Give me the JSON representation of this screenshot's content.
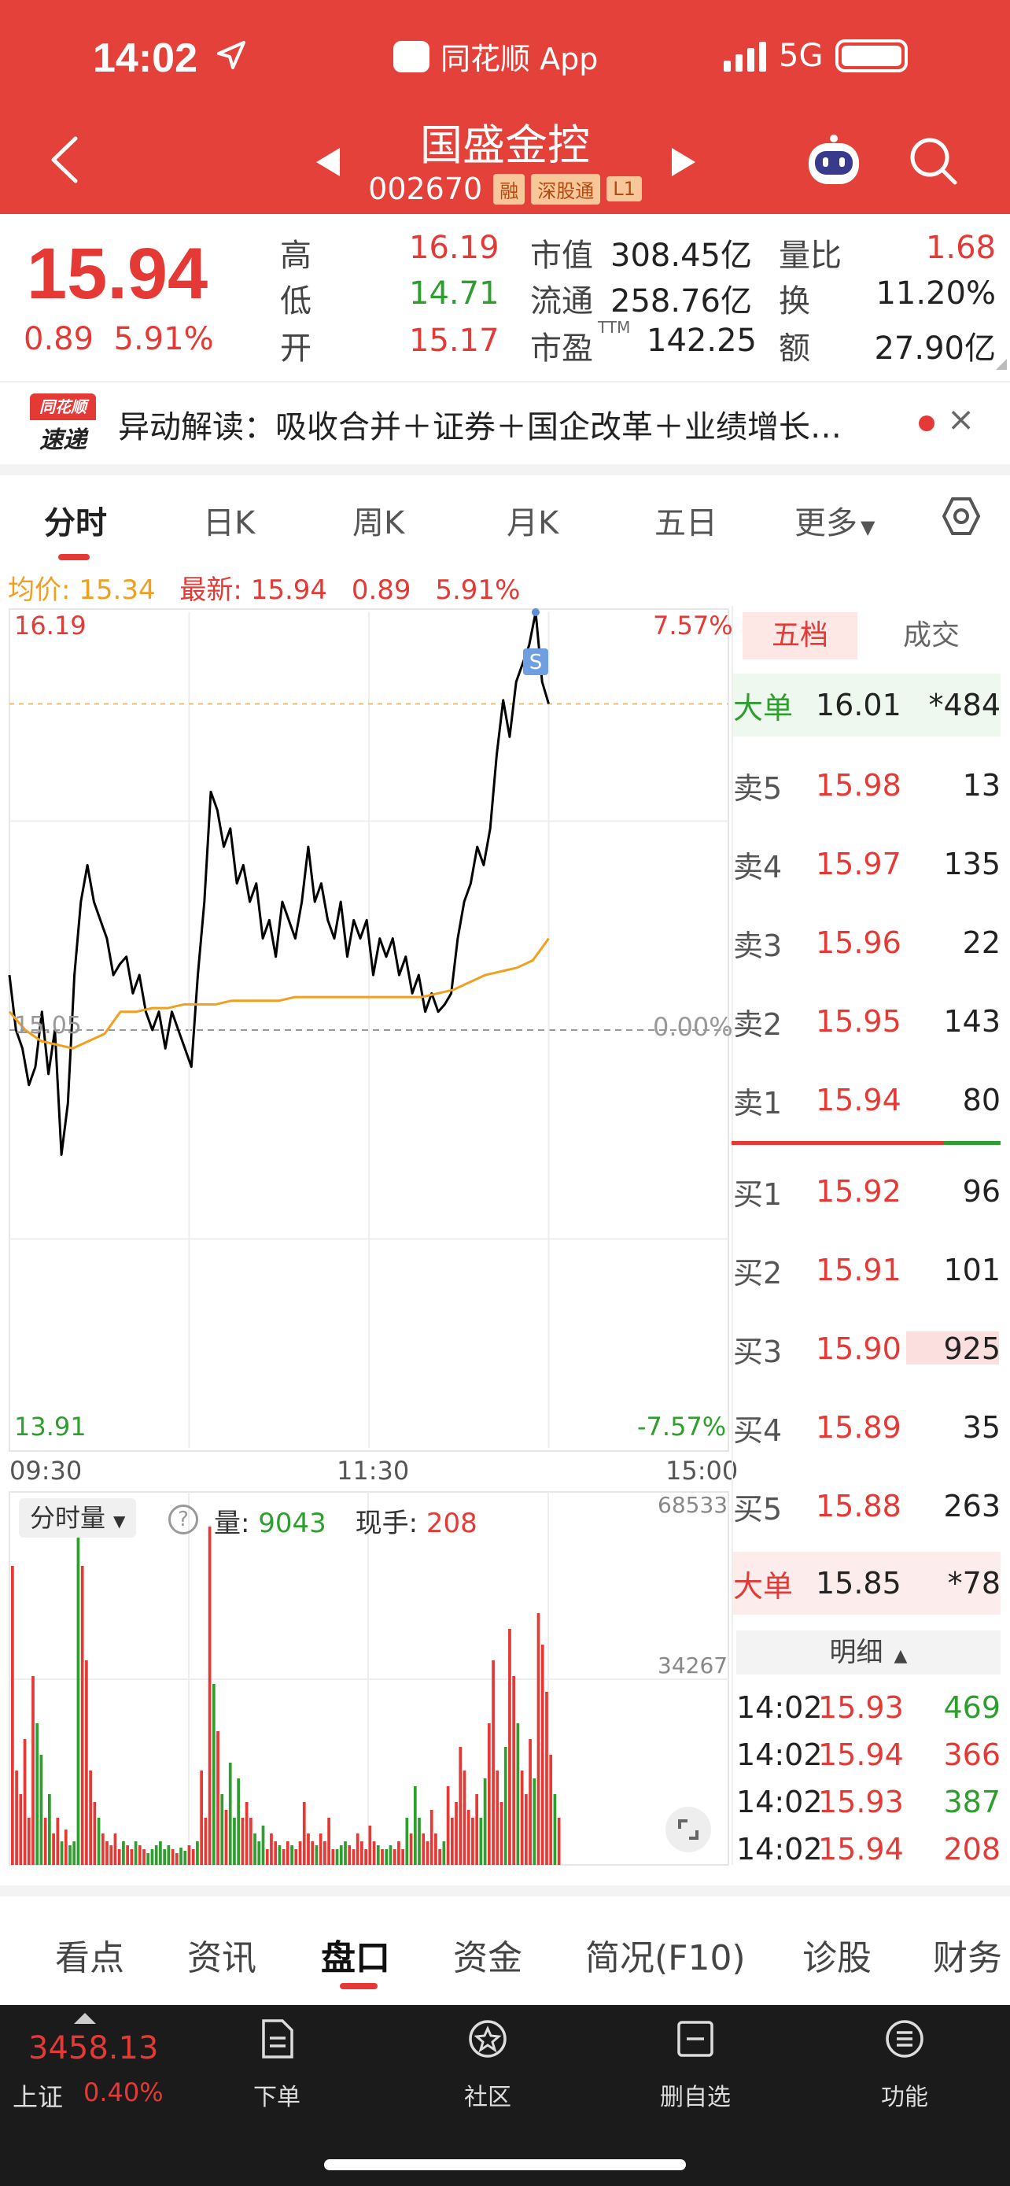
{
  "status": {
    "time": "14:02",
    "app": "同花顺 App",
    "network": "5G"
  },
  "header": {
    "title": "国盛金控",
    "code": "002670",
    "tags": [
      "融",
      "深股通",
      "L1"
    ]
  },
  "quote": {
    "price": "15.94",
    "change": "0.89",
    "change_pct": "5.91%",
    "high_label": "高",
    "high": "16.19",
    "low_label": "低",
    "low": "14.71",
    "open_label": "开",
    "open": "15.17",
    "mktcap_label": "市值",
    "mktcap": "308.45亿",
    "float_label": "流通",
    "float": "258.76亿",
    "pe_label": "市盈",
    "pe_sup": "TTM",
    "pe": "142.25",
    "vr_label": "量比",
    "vr": "1.68",
    "turnover_label": "换",
    "turnover": "11.20%",
    "amount_label": "额",
    "amount": "27.90亿"
  },
  "news": {
    "logo_top": "同花顺",
    "logo_bottom": "速递",
    "text": "异动解读：吸收合并＋证券＋国企改革＋业绩增长…",
    "close": "×"
  },
  "tabs": [
    "分时",
    "日K",
    "周K",
    "月K",
    "五日",
    "更多"
  ],
  "chart_info": {
    "avg_label": "均价: ",
    "avg": "15.34",
    "latest_label": "最新: ",
    "latest": "15.94",
    "chg": "0.89",
    "chg_pct": "5.91%"
  },
  "chart_data": {
    "type": "line",
    "series": [
      {
        "name": "价格",
        "color": "#000000",
        "values": [
          15.2,
          15.05,
          15.0,
          14.9,
          14.95,
          15.1,
          14.93,
          15.05,
          14.71,
          14.85,
          15.2,
          15.4,
          15.5,
          15.4,
          15.35,
          15.3,
          15.2,
          15.23,
          15.25,
          15.15,
          15.2,
          15.1,
          15.05,
          15.1,
          15.0,
          15.1,
          15.05,
          15.0,
          14.95,
          15.2,
          15.4,
          15.7,
          15.65,
          15.55,
          15.6,
          15.45,
          15.5,
          15.4,
          15.45,
          15.3,
          15.35,
          15.25,
          15.4,
          15.35,
          15.3,
          15.4,
          15.55,
          15.4,
          15.45,
          15.35,
          15.3,
          15.4,
          15.25,
          15.35,
          15.3,
          15.35,
          15.2,
          15.3,
          15.25,
          15.3,
          15.2,
          15.25,
          15.15,
          15.2,
          15.1,
          15.15,
          15.1,
          15.12,
          15.15,
          15.3,
          15.4,
          15.45,
          15.55,
          15.5,
          15.6,
          15.8,
          15.95,
          15.85,
          16.0,
          16.05,
          16.1,
          16.19,
          16.0,
          15.94
        ]
      },
      {
        "name": "均价",
        "color": "#f0a020",
        "values": [
          15.1,
          15.05,
          15.02,
          15.01,
          15.0,
          15.02,
          15.04,
          15.1,
          15.1,
          15.11,
          15.11,
          15.12,
          15.12,
          15.12,
          15.13,
          15.13,
          15.13,
          15.13,
          15.14,
          15.14,
          15.14,
          15.14,
          15.14,
          15.14,
          15.14,
          15.14,
          15.14,
          15.15,
          15.16,
          15.18,
          15.2,
          15.21,
          15.22,
          15.24,
          15.3
        ]
      }
    ],
    "ylim": [
      13.91,
      16.19
    ],
    "prev_close": "15.05",
    "y_labels": {
      "top": "16.19",
      "bottom": "13.91",
      "top_pct": "7.57%",
      "bottom_pct": "-7.57%",
      "mid_pct": "0.00%"
    },
    "x_labels": [
      "09:30",
      "11:30",
      "15:00"
    ]
  },
  "volume": {
    "selector": "分时量",
    "vol_label": "量: ",
    "vol": "9043",
    "hand_label": "现手: ",
    "hand": "208",
    "max": "68533",
    "mid": "34267"
  },
  "orderbook": {
    "tab_active": "五档",
    "tab_other": "成交",
    "big_sell": {
      "label": "大单",
      "price": "16.01",
      "vol": "*484"
    },
    "asks": [
      {
        "label": "卖5",
        "price": "15.98",
        "vol": "13"
      },
      {
        "label": "卖4",
        "price": "15.97",
        "vol": "135"
      },
      {
        "label": "卖3",
        "price": "15.96",
        "vol": "22"
      },
      {
        "label": "卖2",
        "price": "15.95",
        "vol": "143"
      },
      {
        "label": "卖1",
        "price": "15.94",
        "vol": "80"
      }
    ],
    "bids": [
      {
        "label": "买1",
        "price": "15.92",
        "vol": "96"
      },
      {
        "label": "买2",
        "price": "15.91",
        "vol": "101"
      },
      {
        "label": "买3",
        "price": "15.90",
        "vol": "925"
      },
      {
        "label": "买4",
        "price": "15.89",
        "vol": "35"
      },
      {
        "label": "买5",
        "price": "15.88",
        "vol": "263"
      }
    ],
    "big_buy": {
      "label": "大单",
      "price": "15.85",
      "vol": "*78"
    },
    "detail_label": "明细",
    "ticks": [
      {
        "time": "14:02",
        "price": "15.93",
        "vol": "469"
      },
      {
        "time": "14:02",
        "price": "15.94",
        "vol": "366"
      },
      {
        "time": "14:02",
        "price": "15.93",
        "vol": "387"
      },
      {
        "time": "14:02",
        "price": "15.94",
        "vol": "208"
      }
    ]
  },
  "bottom_tabs": [
    "看点",
    "资讯",
    "盘口",
    "资金",
    "简况(F10)",
    "诊股",
    "财务"
  ],
  "nav": {
    "index_value": "3458.13",
    "index_name": "上证",
    "index_pct": "0.40%",
    "items": [
      "下单",
      "社区",
      "删自选",
      "功能"
    ]
  }
}
